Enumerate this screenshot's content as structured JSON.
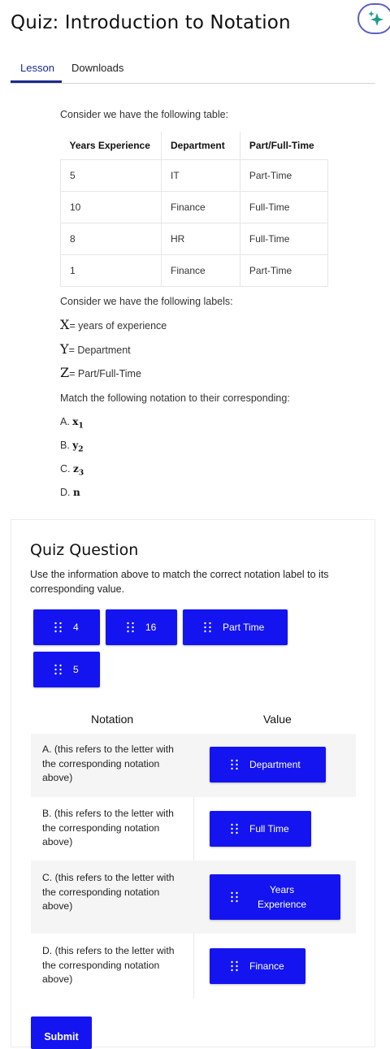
{
  "header": {
    "title": "Quiz: Introduction to Notation",
    "accent": "#1b2b8a"
  },
  "tabs": [
    {
      "label": "Lesson",
      "active": true
    },
    {
      "label": "Downloads",
      "active": false
    }
  ],
  "lesson": {
    "intro": "Consider we have the following table:",
    "table": {
      "headers": [
        "Years Experience",
        "Department",
        "Part/Full-Time"
      ],
      "rows": [
        [
          "5",
          "IT",
          "Part-Time"
        ],
        [
          "10",
          "Finance",
          "Full-Time"
        ],
        [
          "8",
          "HR",
          "Full-Time"
        ],
        [
          "1",
          "Finance",
          "Part-Time"
        ]
      ]
    },
    "labels_intro": "Consider we have the following labels:",
    "labels": [
      {
        "symbol": "X",
        "text": "= years of experience"
      },
      {
        "symbol": "Y",
        "text": "= Department"
      },
      {
        "symbol": "Z",
        "text": "= Part/Full-Time"
      }
    ],
    "match_intro": "Match the following notation to their corresponding:",
    "items": [
      {
        "prefix": "A.",
        "base": "x",
        "sub": "1"
      },
      {
        "prefix": "B.",
        "base": "y",
        "sub": "2"
      },
      {
        "prefix": "C.",
        "base": "z",
        "sub": "3"
      },
      {
        "prefix": "D.",
        "base": "n",
        "sub": ""
      }
    ]
  },
  "quiz": {
    "title": "Quiz Question",
    "instruction": "Use the information above to match the correct notation label to its corresponding value.",
    "chips": [
      "4",
      "16",
      "Part Time",
      "5"
    ],
    "notation_header": "Notation",
    "value_header": "Value",
    "rows": [
      {
        "notation": "A. (this refers to the letter with the corresponding notation above)",
        "value": "Department"
      },
      {
        "notation": "B. (this refers to the letter with the corresponding notation above)",
        "value": "Full Time"
      },
      {
        "notation": "C. (this refers to the letter with the corresponding notation above)",
        "value": "Years Experience"
      },
      {
        "notation": "D. (this refers to the letter with the corresponding notation above)",
        "value": "Finance"
      }
    ],
    "submit_label": "Submit",
    "chip_color": "#1414f0"
  }
}
